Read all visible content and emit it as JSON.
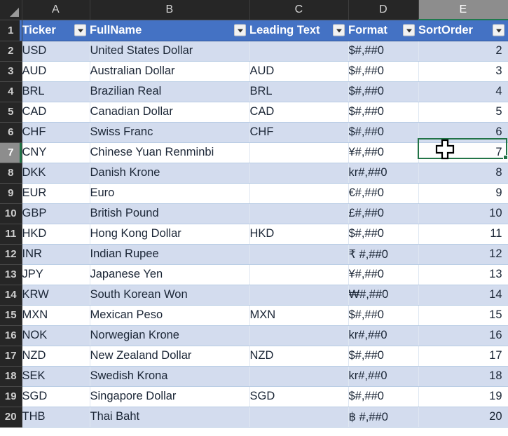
{
  "app": {
    "kind": "spreadsheet-grid",
    "accent_header_color": "#4472c4",
    "band_color": "#d3dcee",
    "selection_color": "#217346",
    "column_header_bg": "#262626"
  },
  "corner": {
    "name": "select-all"
  },
  "columns": [
    {
      "letter": "A",
      "active": false
    },
    {
      "letter": "B",
      "active": false
    },
    {
      "letter": "C",
      "active": false
    },
    {
      "letter": "D",
      "active": false
    },
    {
      "letter": "E",
      "active": true
    }
  ],
  "table": {
    "headers": [
      {
        "label": "Ticker",
        "filter": true
      },
      {
        "label": "FullName",
        "filter": true
      },
      {
        "label": "Leading Text",
        "filter": true
      },
      {
        "label": "Format",
        "filter": true
      },
      {
        "label": "SortOrder",
        "filter": true
      }
    ]
  },
  "selection": {
    "cell": "E7",
    "row": 7,
    "column": "E",
    "value": "7"
  },
  "rows": [
    {
      "n": "1",
      "header": true
    },
    {
      "n": "2",
      "ticker": "USD",
      "fullname": "United States Dollar",
      "leading": "",
      "format": "$#,##0",
      "sortorder": "2"
    },
    {
      "n": "3",
      "ticker": "AUD",
      "fullname": "Australian Dollar",
      "leading": "AUD",
      "format": "$#,##0",
      "sortorder": "3"
    },
    {
      "n": "4",
      "ticker": "BRL",
      "fullname": "Brazilian Real",
      "leading": "BRL",
      "format": "$#,##0",
      "sortorder": "4"
    },
    {
      "n": "5",
      "ticker": "CAD",
      "fullname": "Canadian Dollar",
      "leading": "CAD",
      "format": "$#,##0",
      "sortorder": "5"
    },
    {
      "n": "6",
      "ticker": "CHF",
      "fullname": "Swiss Franc",
      "leading": "CHF",
      "format": "$#,##0",
      "sortorder": "6"
    },
    {
      "n": "7",
      "ticker": "CNY",
      "fullname": "Chinese Yuan Renminbi",
      "leading": "",
      "format": "¥#,##0",
      "sortorder": "7"
    },
    {
      "n": "8",
      "ticker": "DKK",
      "fullname": "Danish Krone",
      "leading": "",
      "format": "kr#,##0",
      "sortorder": "8"
    },
    {
      "n": "9",
      "ticker": "EUR",
      "fullname": "Euro",
      "leading": "",
      "format": "€#,##0",
      "sortorder": "9"
    },
    {
      "n": "10",
      "ticker": "GBP",
      "fullname": "British Pound",
      "leading": "",
      "format": "£#,##0",
      "sortorder": "10"
    },
    {
      "n": "11",
      "ticker": "HKD",
      "fullname": "Hong Kong Dollar",
      "leading": "HKD",
      "format": "$#,##0",
      "sortorder": "11"
    },
    {
      "n": "12",
      "ticker": "INR",
      "fullname": "Indian Rupee",
      "leading": "",
      "format": "₹ #,##0",
      "sortorder": "12"
    },
    {
      "n": "13",
      "ticker": "JPY",
      "fullname": "Japanese Yen",
      "leading": "",
      "format": "¥#,##0",
      "sortorder": "13"
    },
    {
      "n": "14",
      "ticker": "KRW",
      "fullname": "South Korean Won",
      "leading": "",
      "format": "₩#,##0",
      "sortorder": "14"
    },
    {
      "n": "15",
      "ticker": "MXN",
      "fullname": "Mexican Peso",
      "leading": "MXN",
      "format": "$#,##0",
      "sortorder": "15"
    },
    {
      "n": "16",
      "ticker": "NOK",
      "fullname": "Norwegian Krone",
      "leading": "",
      "format": "kr#,##0",
      "sortorder": "16"
    },
    {
      "n": "17",
      "ticker": "NZD",
      "fullname": "New Zealand Dollar",
      "leading": "NZD",
      "format": "$#,##0",
      "sortorder": "17"
    },
    {
      "n": "18",
      "ticker": "SEK",
      "fullname": "Swedish Krona",
      "leading": "",
      "format": "kr#,##0",
      "sortorder": "18"
    },
    {
      "n": "19",
      "ticker": "SGD",
      "fullname": "Singapore Dollar",
      "leading": "SGD",
      "format": "$#,##0",
      "sortorder": "19"
    },
    {
      "n": "20",
      "ticker": "THB",
      "fullname": "Thai Baht",
      "leading": "",
      "format": "฿ #,##0",
      "sortorder": "20"
    }
  ]
}
